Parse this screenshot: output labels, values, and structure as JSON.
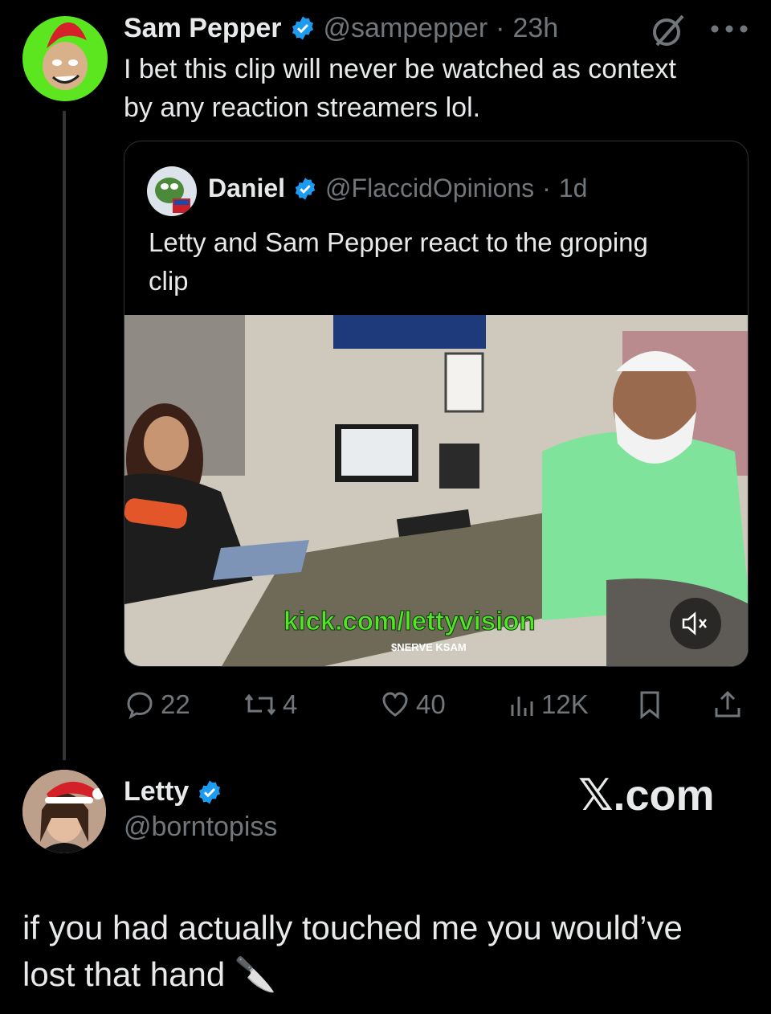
{
  "post": {
    "author_name": "Sam Pepper",
    "handle": "@sampepper",
    "time": "23h",
    "dot": "·",
    "text_line1": "I bet this clip will never be watched as context",
    "text_line2": "by any reaction streamers lol.",
    "grok_icon": "slash-circle-icon",
    "more_icon": "more-dots-icon"
  },
  "quote": {
    "author_name": "Daniel",
    "handle": "@FlaccidOpinions",
    "time": "1d",
    "text_line1": "Letty and Sam Pepper react to the groping",
    "text_line2": "clip",
    "video": {
      "watermark": "kick.com/lettyvision",
      "overlay_text": "$NERVE KSAM",
      "mute_icon": "speaker-muted-icon"
    }
  },
  "actions": {
    "replies": "22",
    "reposts": "4",
    "likes": "40",
    "views": "12K"
  },
  "reply_card": {
    "author_name": "Letty",
    "handle": "@borntopiss",
    "brand": "𝕏.com",
    "text_line1": "if you had actually touched me you would’ve",
    "text_line2": "lost that hand",
    "emoji": "🔪"
  },
  "colors": {
    "verified": "#1d9bf0",
    "muted": "#71767b",
    "green_avatar": "#5ce61f"
  }
}
